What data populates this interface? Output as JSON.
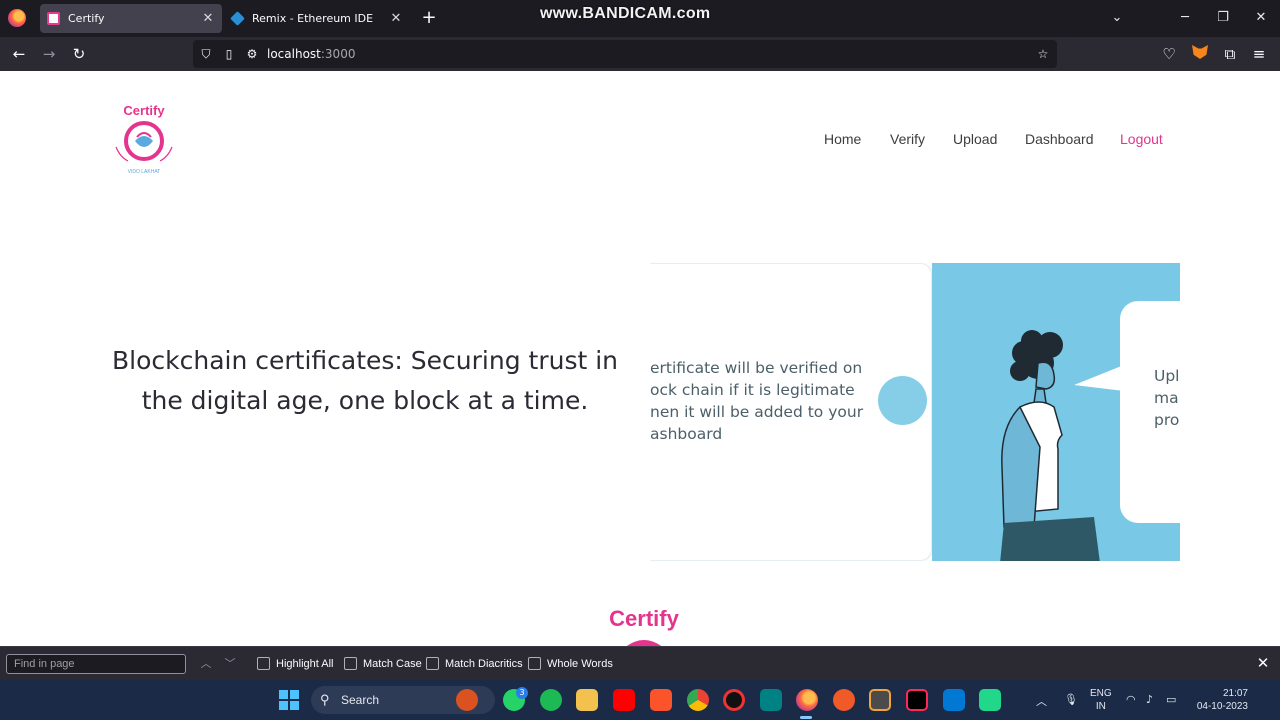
{
  "browser": {
    "tabs": [
      {
        "label": "Certify",
        "active": true
      },
      {
        "label": "Remix - Ethereum IDE",
        "active": false
      }
    ],
    "watermark": "www.BANDICAM.com",
    "url": {
      "host": "localhost",
      "port": ":3000"
    }
  },
  "site": {
    "nav": [
      "Home",
      "Verify",
      "Upload",
      "Dashboard",
      "Logout"
    ],
    "logo_text": "Certify",
    "logo_subtext": "VIDO LAKHAT",
    "hero": "Blockchain certificates: Securing trust in the digital age, one block at a time.",
    "slider": {
      "card_text": "ertificate will be verified on\nock chain if it is legitimate\nnen it will be added to your\nashboard",
      "bubble_text": "Upl\nmal\npro"
    },
    "accent_color": "#e5348e"
  },
  "findbar": {
    "placeholder": "Find in page",
    "options": [
      "Highlight All",
      "Match Case",
      "Match Diacritics",
      "Whole Words"
    ]
  },
  "taskbar": {
    "search_label": "Search",
    "whatsapp_badge": "3",
    "lang_line1": "ENG",
    "lang_line2": "IN",
    "time": "21:07",
    "date": "04-10-2023"
  }
}
